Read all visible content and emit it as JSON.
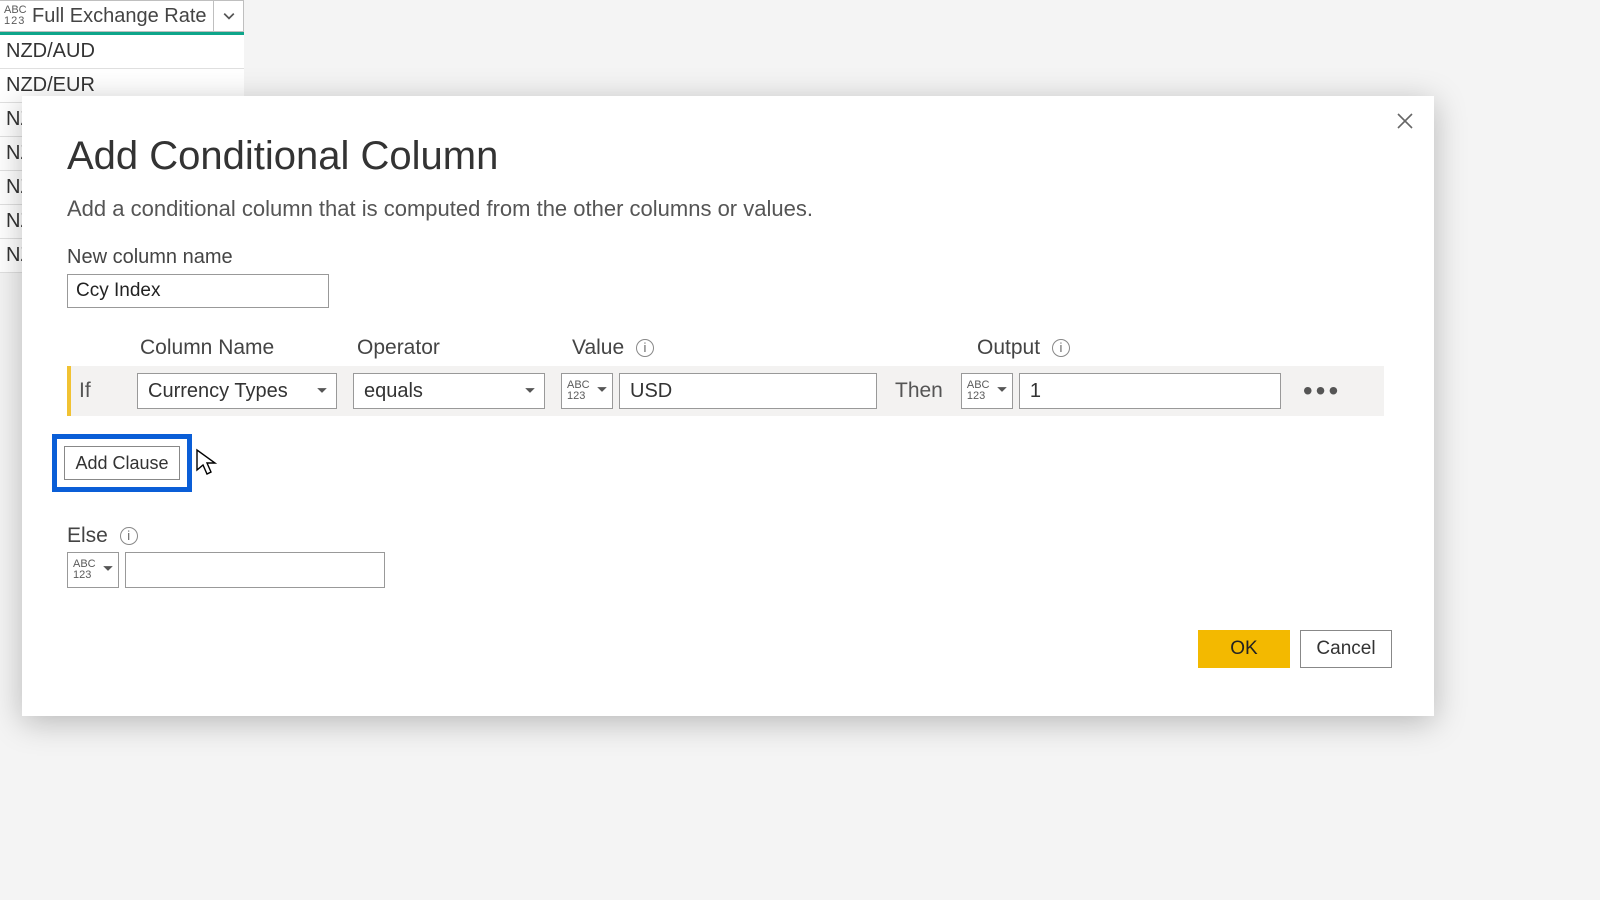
{
  "background": {
    "column_header": "Full Exchange Rate",
    "type_token": {
      "top": "ABC",
      "bottom": "123"
    },
    "rows": [
      "NZD/AUD",
      "NZD/EUR",
      "NZ",
      "NZ",
      "NZ",
      "NZ",
      "NZ"
    ]
  },
  "dialog": {
    "title": "Add Conditional Column",
    "subtitle": "Add a conditional column that is computed from the other columns or values.",
    "newcol_label": "New column name",
    "newcol_value": "Ccy Index",
    "headers": {
      "colname": "Column Name",
      "operator": "Operator",
      "value": "Value",
      "output": "Output"
    },
    "clause": {
      "if": "If",
      "column": "Currency Types",
      "operator": "equals",
      "value": "USD",
      "then": "Then",
      "output": "1"
    },
    "add_clause": "Add Clause",
    "else_label": "Else",
    "else_value": "",
    "ok": "OK",
    "cancel": "Cancel"
  },
  "type_token": {
    "top": "ABC",
    "bottom": "123"
  }
}
